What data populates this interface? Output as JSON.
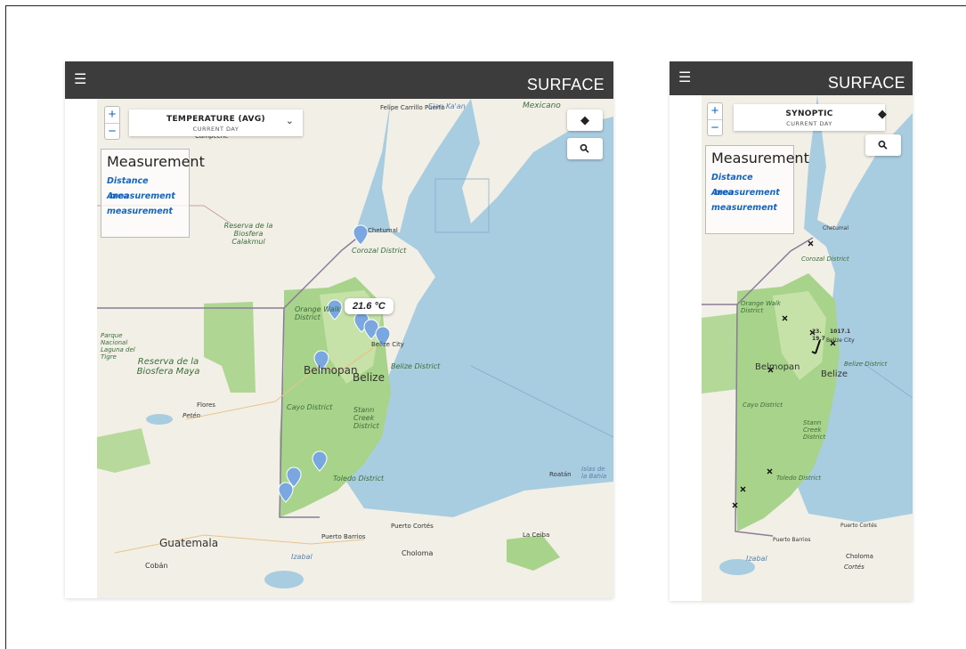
{
  "brand": "SURFACE",
  "left_app": {
    "selector": {
      "title": "TEMPERATURE (AVG)",
      "subtitle": "CURRENT DAY"
    },
    "measurement": {
      "title": "Measurement",
      "distance": "Distance",
      "area": "Area",
      "measurement_word": "measurement"
    },
    "tooltip": "21.6 °C",
    "labels": {
      "felipe": "Felipe Carrillo Puerto",
      "mexicano": "Mexicano",
      "reserva_calakmul": "Reserva de la Biosfera Calakmul",
      "corozal": "Corozal District",
      "orange_walk": "Orange Walk District",
      "belmopan": "Belmopan",
      "belize": "Belize",
      "belize_city": "Belize City",
      "belize_district": "Belize District",
      "cayo": "Cayo District",
      "stann": "Stann Creek District",
      "toledo": "Toledo District",
      "reserva_maya": "Reserva de la Biosfera Maya",
      "parque": "Parque Nacional Laguna del Tigre",
      "flores": "Flores",
      "peten": "Petén",
      "guatemala": "Guatemala",
      "coban": "Cobán",
      "puerto_barrios": "Puerto Barrios",
      "puerto_cortes": "Puerto Cortés",
      "roatan": "Roatán",
      "islas": "Islas de la Bahía",
      "la_ceiba": "La Ceiba",
      "izabal": "Izabal",
      "choloma": "Choloma",
      "campeche": "Campeche",
      "chetumal": "Chetumal",
      "sian_kaan": "Sian Ka'an"
    }
  },
  "right_app": {
    "selector": {
      "title": "SYNOPTIC",
      "subtitle": "CURRENT DAY"
    },
    "measurement": {
      "title": "Measurement",
      "distance": "Distance",
      "area": "Area",
      "measurement_word": "measurement"
    },
    "obs": {
      "t": "23.",
      "td": "19.7",
      "p": "1017.1"
    },
    "labels": {
      "chetumal": "Chetumal",
      "corozal": "Corozal District",
      "orange_walk": "Orange Walk District",
      "belmopan": "Belmopan",
      "belize": "Belize",
      "belize_city": "Belize City",
      "belize_district": "Belize District",
      "cayo": "Cayo District",
      "stann": "Stann Creek District",
      "toledo": "Toledo District",
      "puerto_barrios": "Puerto Barrios",
      "puerto_cortes": "Puerto Cortés",
      "choloma": "Choloma",
      "izabal": "Izabal",
      "cortes": "Cortés"
    }
  },
  "icons": {
    "menu": "☰",
    "layers": "◆",
    "search": "⚲",
    "chevron": "⌄",
    "zoom_in": "+",
    "zoom_out": "−"
  },
  "colors": {
    "appbar": "#3c3c3c",
    "water": "#a9cde0",
    "land": "#f2efe6",
    "forest": "#a8d38a",
    "marker": "#7aa7e0",
    "link": "#1565c0"
  }
}
